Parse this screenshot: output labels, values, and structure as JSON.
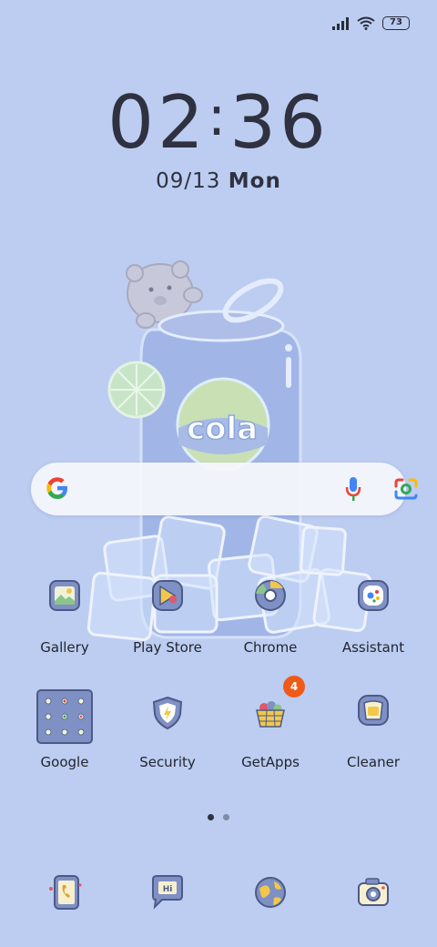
{
  "status_bar": {
    "signal_icon": "signal-bars-icon",
    "wifi_icon": "wifi-icon",
    "battery_level": "73"
  },
  "clock": {
    "hours": "02",
    "minutes": "36",
    "date": "09/13",
    "weekday": "Mon"
  },
  "wallpaper": {
    "can_text": "cola"
  },
  "search": {
    "google_icon": "google-g-icon",
    "mic_icon": "mic-icon",
    "lens_icon": "lens-camera-icon"
  },
  "apps": [
    {
      "label": "Gallery",
      "icon": "gallery-icon"
    },
    {
      "label": "Play Store",
      "icon": "play-store-icon"
    },
    {
      "label": "Chrome",
      "icon": "chrome-icon"
    },
    {
      "label": "Assistant",
      "icon": "assistant-icon"
    },
    {
      "label": "Google",
      "icon": "google-folder-icon"
    },
    {
      "label": "Security",
      "icon": "security-icon"
    },
    {
      "label": "GetApps",
      "icon": "getapps-icon",
      "badge": "4"
    },
    {
      "label": "Cleaner",
      "icon": "cleaner-icon"
    }
  ],
  "pager": {
    "pages": 2,
    "active": 1
  },
  "dock": [
    {
      "icon": "phone-icon"
    },
    {
      "icon": "messages-icon"
    },
    {
      "icon": "browser-globe-icon"
    },
    {
      "icon": "camera-icon"
    }
  ],
  "colors": {
    "background": "#bccdf1",
    "badge": "#f05a18",
    "icon_outline": "#4d5a86"
  }
}
